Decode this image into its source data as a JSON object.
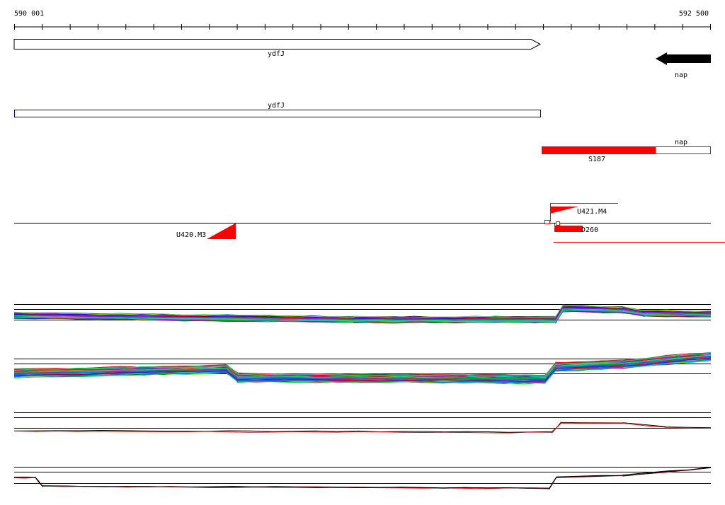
{
  "ruler": {
    "start_label": "590 001",
    "end_label": "592 500",
    "start": 590001,
    "end": 592500,
    "tick_count": 25
  },
  "genes": [
    {
      "name": "ydfJ",
      "strand": "+",
      "start": 590001,
      "end": 591890,
      "style": "outline"
    },
    {
      "name": "nap",
      "strand": "-",
      "start": 592262,
      "end": 592500,
      "style": "filled"
    }
  ],
  "cds": [
    {
      "name": "ydfJ",
      "start": 590001,
      "end": 591890,
      "color": "#0000aa",
      "fill": 0.0
    },
    {
      "name": "nap",
      "start": 591895,
      "end": 592500,
      "color": "#ff0000",
      "fill": 0.67
    }
  ],
  "protein_label": "S187",
  "features": {
    "U420_M3": "U420.M3",
    "U421_M4": "U421.M4",
    "D260": "D260"
  },
  "colors": {
    "accent_red": "#ff0000",
    "outline_blue": "#0000aa",
    "axis": "#000000"
  }
}
